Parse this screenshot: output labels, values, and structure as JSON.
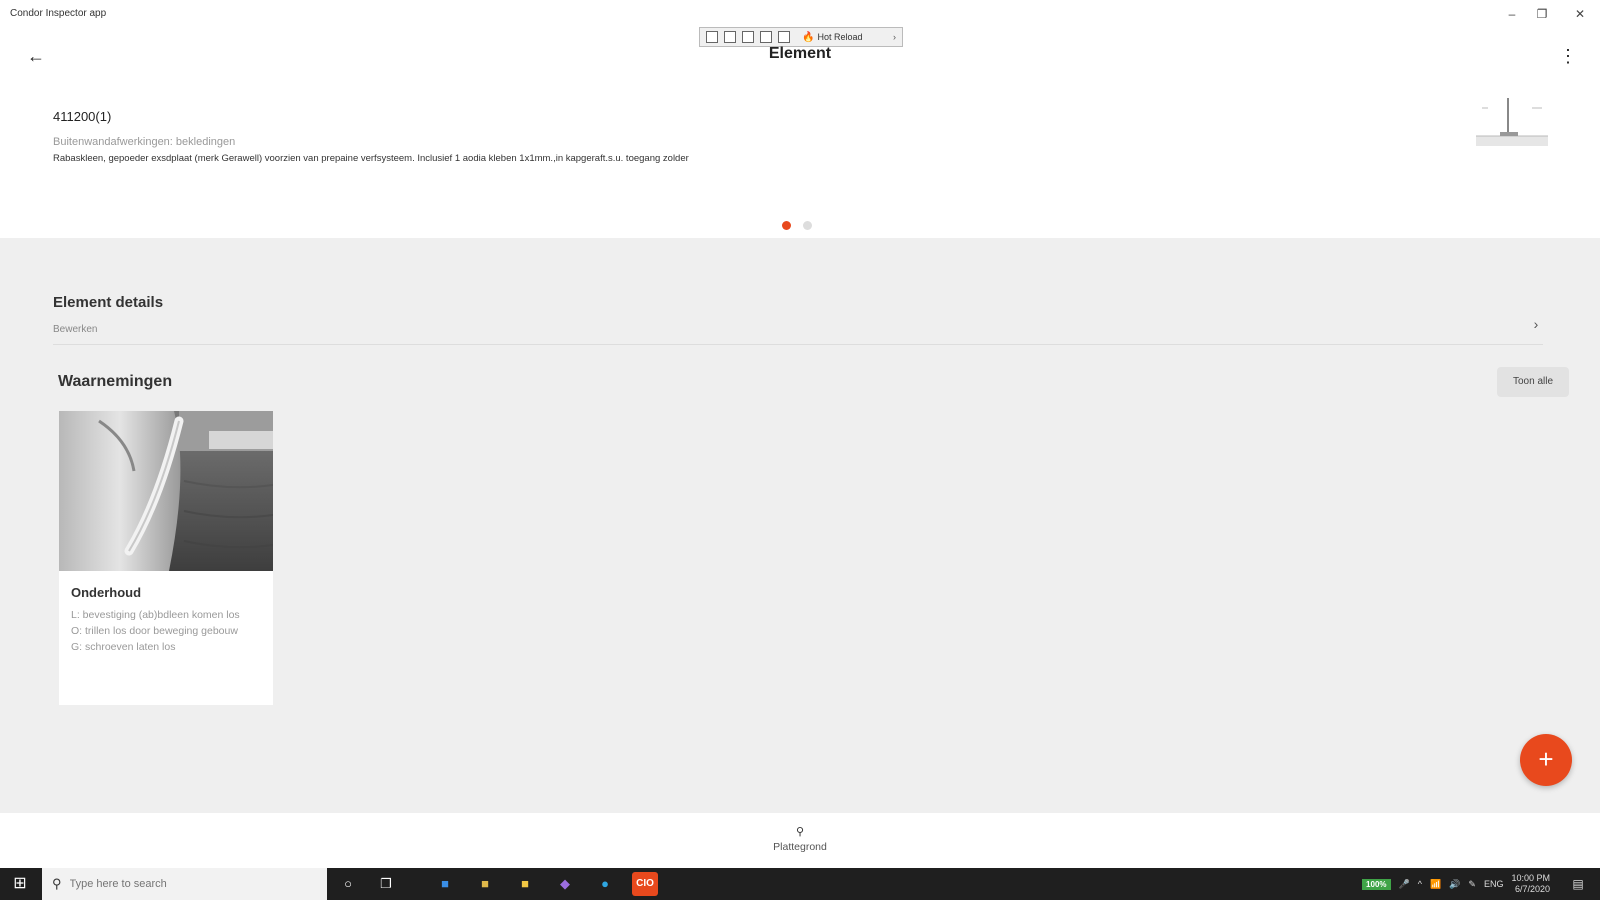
{
  "window": {
    "title": "Condor Inspector app",
    "minimize": "–",
    "restore": "❐",
    "close": "✕"
  },
  "debug_toolbar": {
    "hot_reload_label": "Hot Reload",
    "chevron": "›"
  },
  "header": {
    "back_glyph": "←",
    "title": "Element",
    "more_glyph": "⋮"
  },
  "element": {
    "code": "411200(1)",
    "category": "Buitenwandafwerkingen: bekledingen",
    "description": "Rabaskleen, gepoeder exsdplaat (merk Gerawell) voorzien van prepaine verfsysteem. Inclusief 1 aodia kleben 1x1mm.,in kapgeraft.s.u. toegang zolder",
    "carousel": {
      "active_index": 0,
      "count": 2
    }
  },
  "details": {
    "title": "Element details",
    "subtitle": "Bewerken",
    "chevron": "›"
  },
  "observations": {
    "title": "Waarnemingen",
    "show_all_label": "Toon alle",
    "cards": [
      {
        "title": "Onderhoud",
        "lines": [
          "L: bevestiging (ab)bdleen komen los",
          "O: trillen los door beweging gebouw",
          "G: schroeven laten los"
        ]
      }
    ]
  },
  "fab": {
    "glyph": "+"
  },
  "bottom_nav": {
    "icon": "⚲",
    "label": "Plattegrond"
  },
  "taskbar": {
    "start_glyph": "⊞",
    "search_placeholder": "Type here to search",
    "search_icon": "⚲",
    "battery": "100%",
    "language": "ENG",
    "time": "10:00 PM",
    "date": "6/7/2020",
    "colors": {
      "active_app": "#e8491d"
    }
  },
  "theme": {
    "accent": "#e8491d",
    "content_bg": "#efefef"
  }
}
